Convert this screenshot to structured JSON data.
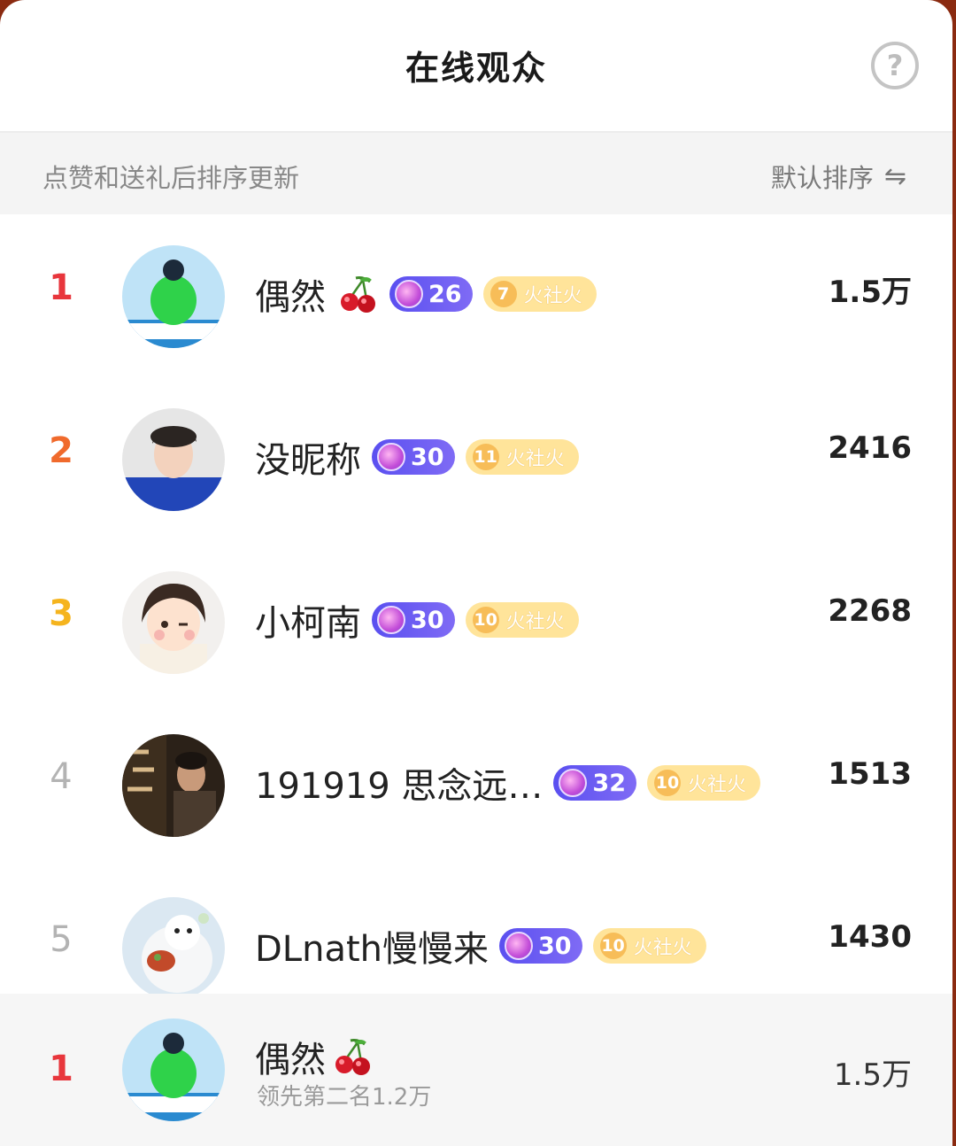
{
  "header": {
    "title": "在线观众",
    "help_symbol": "?"
  },
  "subbar": {
    "hint": "点赞和送礼后排序更新",
    "sort_label": "默认排序",
    "sort_icon": "⇋"
  },
  "fan_badge_text": "火社火",
  "viewers": [
    {
      "rank": "1",
      "name": "偶然",
      "has_cherry": true,
      "level": "26",
      "fan_level": "7",
      "score": "1.5万"
    },
    {
      "rank": "2",
      "name": "没昵称",
      "has_cherry": false,
      "level": "30",
      "fan_level": "11",
      "score": "2416"
    },
    {
      "rank": "3",
      "name": "小柯南",
      "has_cherry": false,
      "level": "30",
      "fan_level": "10",
      "score": "2268"
    },
    {
      "rank": "4",
      "name": "191919 思念远…",
      "has_cherry": false,
      "level": "32",
      "fan_level": "10",
      "score": "1513"
    },
    {
      "rank": "5",
      "name": "DLnath慢慢来",
      "has_cherry": false,
      "level": "30",
      "fan_level": "10",
      "score": "1430"
    }
  ],
  "me": {
    "rank": "1",
    "name": "偶然",
    "sub": "领先第二名1.2万",
    "score": "1.5万"
  },
  "colors": {
    "rank1": "#e8363c",
    "rank2": "#f06a2c",
    "rank3": "#f5b41e",
    "level_badge": "#5a4ff0",
    "fan_badge": "#ffe49a"
  }
}
